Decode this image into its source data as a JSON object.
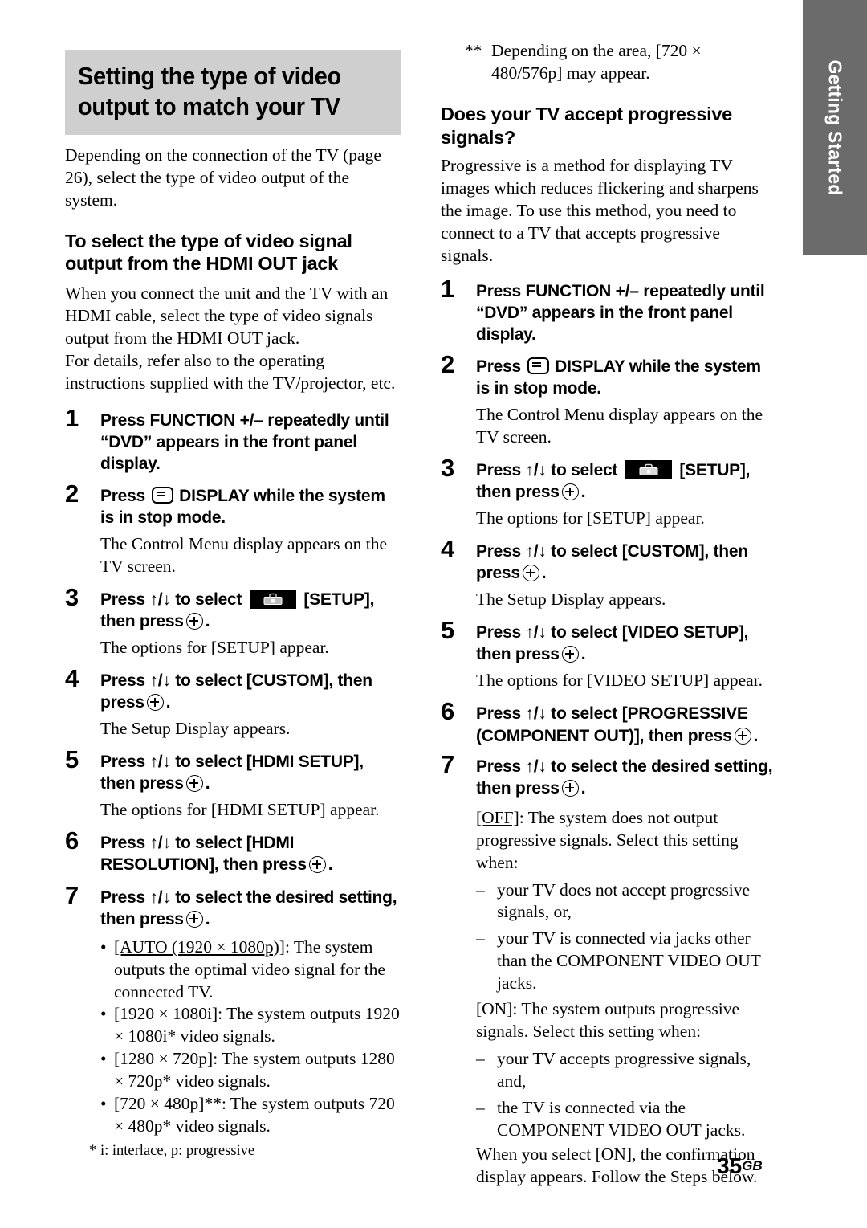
{
  "side_tab": {
    "label": "Getting Started",
    "bg_color": "#6b6b6b",
    "text_color": "#ffffff"
  },
  "page_number": {
    "number": "35",
    "suffix": "GB"
  },
  "title": {
    "line1": "Setting the type of video",
    "line2": "output to match your TV",
    "bg_color": "#cfcfcf"
  },
  "left_column": {
    "intro": "Depending on the connection of the TV (page 26), select the type of video output of the system.",
    "subheading": "To select the type of video signal output from the HDMI OUT jack",
    "subheading_body": "When you connect the unit and the TV with an HDMI cable, select the type of video signals output from the HDMI OUT jack.",
    "subheading_body2": "For details, refer also to the operating instructions supplied with the TV/projector, etc.",
    "step1_num": "1",
    "step1_text": "Press FUNCTION +/– repeatedly until “DVD” appears in the front panel display.",
    "step2_num": "2",
    "step2_a": "Press",
    "step2_b": "DISPLAY while the system is in stop mode.",
    "step2_result": "The Control Menu display appears on the TV screen.",
    "step3_num": "3",
    "step3_a": "Press ↑/↓ to select",
    "step3_b": "[SETUP],",
    "step3_c": "then press",
    "step3_d": ".",
    "step3_result": "The options for [SETUP] appear.",
    "step4_num": "4",
    "step4_a": "Press ↑/↓ to select [CUSTOM], then press",
    "step4_b": ".",
    "step4_result": "The Setup Display appears.",
    "step5_num": "5",
    "step5_a": "Press ↑/↓ to select [HDMI SETUP], then press",
    "step5_b": ".",
    "step5_result": "The options for [HDMI SETUP] appear.",
    "step6_num": "6",
    "step6_a": "Press ↑/↓ to select [HDMI RESOLUTION], then press",
    "step6_b": ".",
    "step7_num": "7",
    "step7_a": "Press ↑/↓ to select the desired setting, then press",
    "step7_b": ".",
    "bullets": [
      {
        "label": "[AUTO (1920 × 1080p)]",
        "underline": true,
        "text": ": The system outputs the optimal video signal for the connected TV."
      },
      {
        "label": "[1920 × 1080i]",
        "underline": false,
        "text": ": The system outputs 1920 × 1080i* video signals."
      },
      {
        "label": "[1280 × 720p]",
        "underline": false,
        "text": ": The system outputs 1280 × 720p* video signals."
      },
      {
        "label": "[720 × 480p]**",
        "underline": false,
        "text": ": The system outputs 720 × 480p* video signals."
      }
    ],
    "footnote_mark": "*",
    "footnote_text": "i: interlace, p: progressive"
  },
  "right_column": {
    "note_mark": "**",
    "note_text": "Depending on the area, [720 × 480/576p] may appear.",
    "subheading": "Does your TV accept progressive signals?",
    "subheading_body": "Progressive is a method for displaying TV images which reduces flickering and sharpens the image. To use this method, you need to connect to a TV that accepts progressive signals.",
    "step1_num": "1",
    "step1_text": "Press FUNCTION +/– repeatedly until “DVD” appears in the front panel display.",
    "step2_num": "2",
    "step2_a": "Press",
    "step2_b": "DISPLAY while the system is in stop mode.",
    "step2_result": "The Control Menu display appears on the TV screen.",
    "step3_num": "3",
    "step3_a": "Press ↑/↓ to select",
    "step3_b": "[SETUP],",
    "step3_c": "then press",
    "step3_d": ".",
    "step3_result": "The options for [SETUP] appear.",
    "step4_num": "4",
    "step4_a": "Press ↑/↓ to select [CUSTOM], then press",
    "step4_b": ".",
    "step4_result": "The Setup Display appears.",
    "step5_num": "5",
    "step5_a": "Press ↑/↓ to select [VIDEO SETUP], then press",
    "step5_b": ".",
    "step5_result": "The options for [VIDEO SETUP] appear.",
    "step6_num": "6",
    "step6_a": "Press ↑/↓ to select [PROGRESSIVE (COMPONENT OUT)], then press",
    "step6_b": ".",
    "step7_num": "7",
    "step7_a": "Press ↑/↓ to select the desired setting, then press",
    "step7_b": ".",
    "off_label": "[OFF]",
    "off_text": ": The system does not output progressive signals. Select this setting when:",
    "off_items": [
      "your TV does not accept progressive signals, or,",
      "your TV is connected via jacks other than the COMPONENT VIDEO OUT jacks."
    ],
    "on_label": "[ON]",
    "on_text": ": The system outputs progressive signals. Select this setting when:",
    "on_items": [
      "your TV accepts progressive signals, and,",
      "the TV is connected via the COMPONENT VIDEO OUT jacks."
    ],
    "closing": "When you select [ON], the confirmation display appears. Follow the Steps below."
  }
}
